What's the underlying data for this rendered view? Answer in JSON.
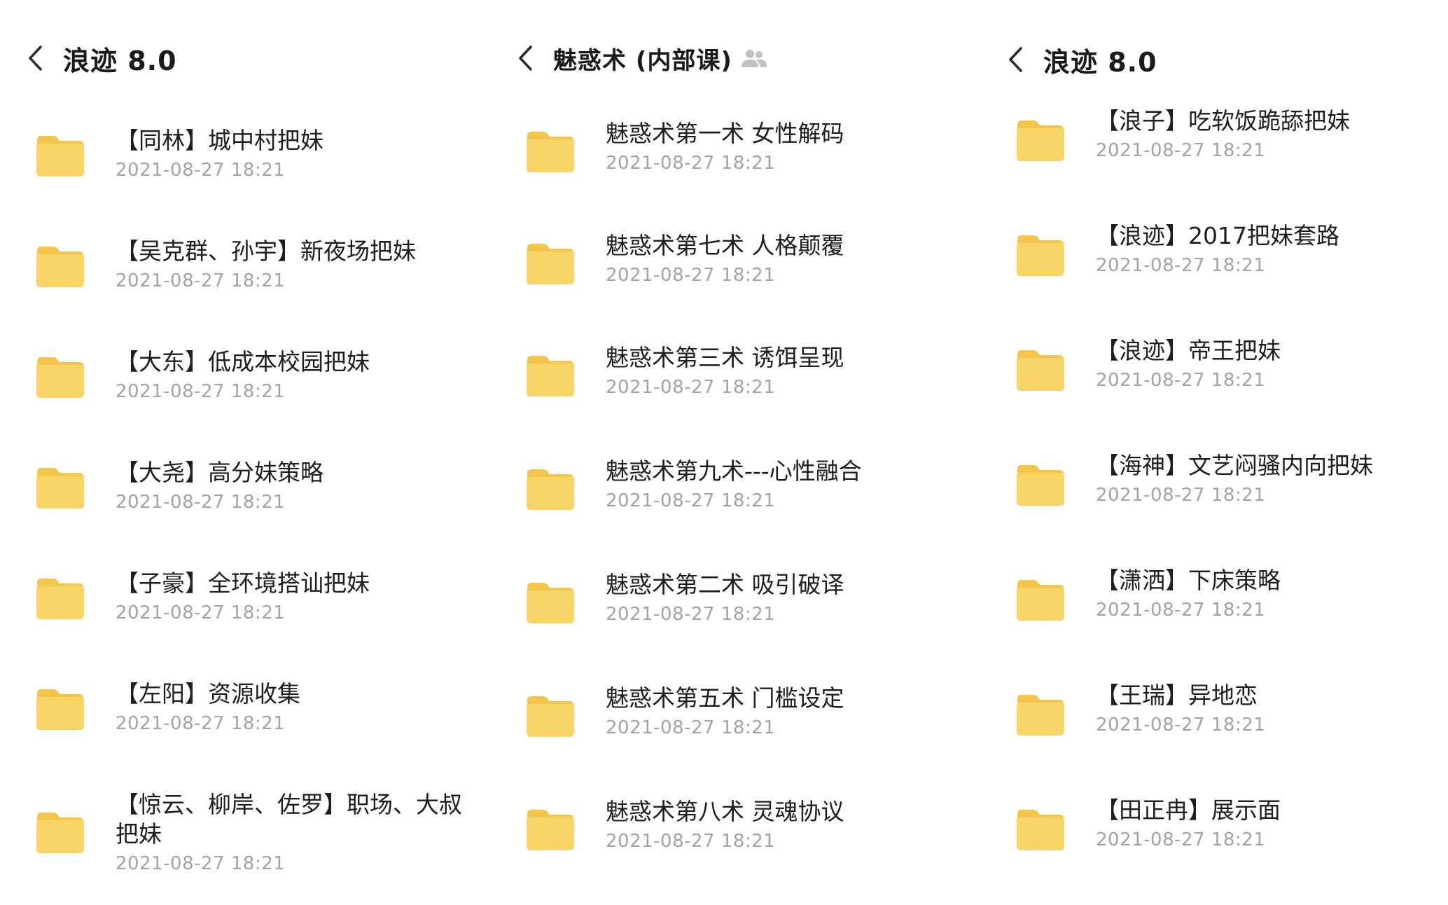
{
  "colors": {
    "folder_body": "#F9D466",
    "folder_tab": "#F3C64B",
    "title_text": "#1a1a1a",
    "meta_text": "#a3a3a3",
    "icon_gray": "#c2c2c2"
  },
  "panels": [
    {
      "title": "浪迹 8.0",
      "back_icon": "chevron-left-icon",
      "items": [
        {
          "name": "【同林】城中村把妹",
          "date": "2021-08-27 18:21"
        },
        {
          "name": "【吴克群、孙宇】新夜场把妹",
          "date": "2021-08-27 18:21"
        },
        {
          "name": "【大东】低成本校园把妹",
          "date": "2021-08-27 18:21"
        },
        {
          "name": "【大尧】高分妹策略",
          "date": "2021-08-27 18:21"
        },
        {
          "name": "【子豪】全环境搭讪把妹",
          "date": "2021-08-27 18:21"
        },
        {
          "name": "【左阳】资源收集",
          "date": "2021-08-27 18:21"
        },
        {
          "name": "【惊云、柳岸、佐罗】职场、大叔把妹",
          "date": "2021-08-27 18:21"
        }
      ]
    },
    {
      "title": "魅惑术 (内部课)",
      "back_icon": "chevron-left-icon",
      "shared_icon": "shared-users-icon",
      "items": [
        {
          "name": "魅惑术第一术  女性解码",
          "date": "2021-08-27 18:21"
        },
        {
          "name": "魅惑术第七术  人格颠覆",
          "date": "2021-08-27 18:21"
        },
        {
          "name": "魅惑术第三术  诱饵呈现",
          "date": "2021-08-27 18:21"
        },
        {
          "name": "魅惑术第九术---心性融合",
          "date": "2021-08-27 18:21"
        },
        {
          "name": "魅惑术第二术   吸引破译",
          "date": "2021-08-27 18:21"
        },
        {
          "name": "魅惑术第五术   门槛设定",
          "date": "2021-08-27 18:21"
        },
        {
          "name": "魅惑术第八术  灵魂协议",
          "date": "2021-08-27 18:21"
        }
      ]
    },
    {
      "title": "浪迹 8.0",
      "back_icon": "chevron-left-icon",
      "items": [
        {
          "name": "【浪子】吃软饭跪舔把妹",
          "date": "2021-08-27 18:21"
        },
        {
          "name": "【浪迹】2017把妹套路",
          "date": "2021-08-27 18:21"
        },
        {
          "name": "【浪迹】帝王把妹",
          "date": "2021-08-27 18:21"
        },
        {
          "name": "【海神】文艺闷骚内向把妹",
          "date": "2021-08-27 18:21"
        },
        {
          "name": "【潇洒】下床策略",
          "date": "2021-08-27 18:21"
        },
        {
          "name": "【王瑞】异地恋",
          "date": "2021-08-27 18:21"
        },
        {
          "name": "【田正冉】展示面",
          "date": "2021-08-27 18:21"
        }
      ]
    }
  ]
}
